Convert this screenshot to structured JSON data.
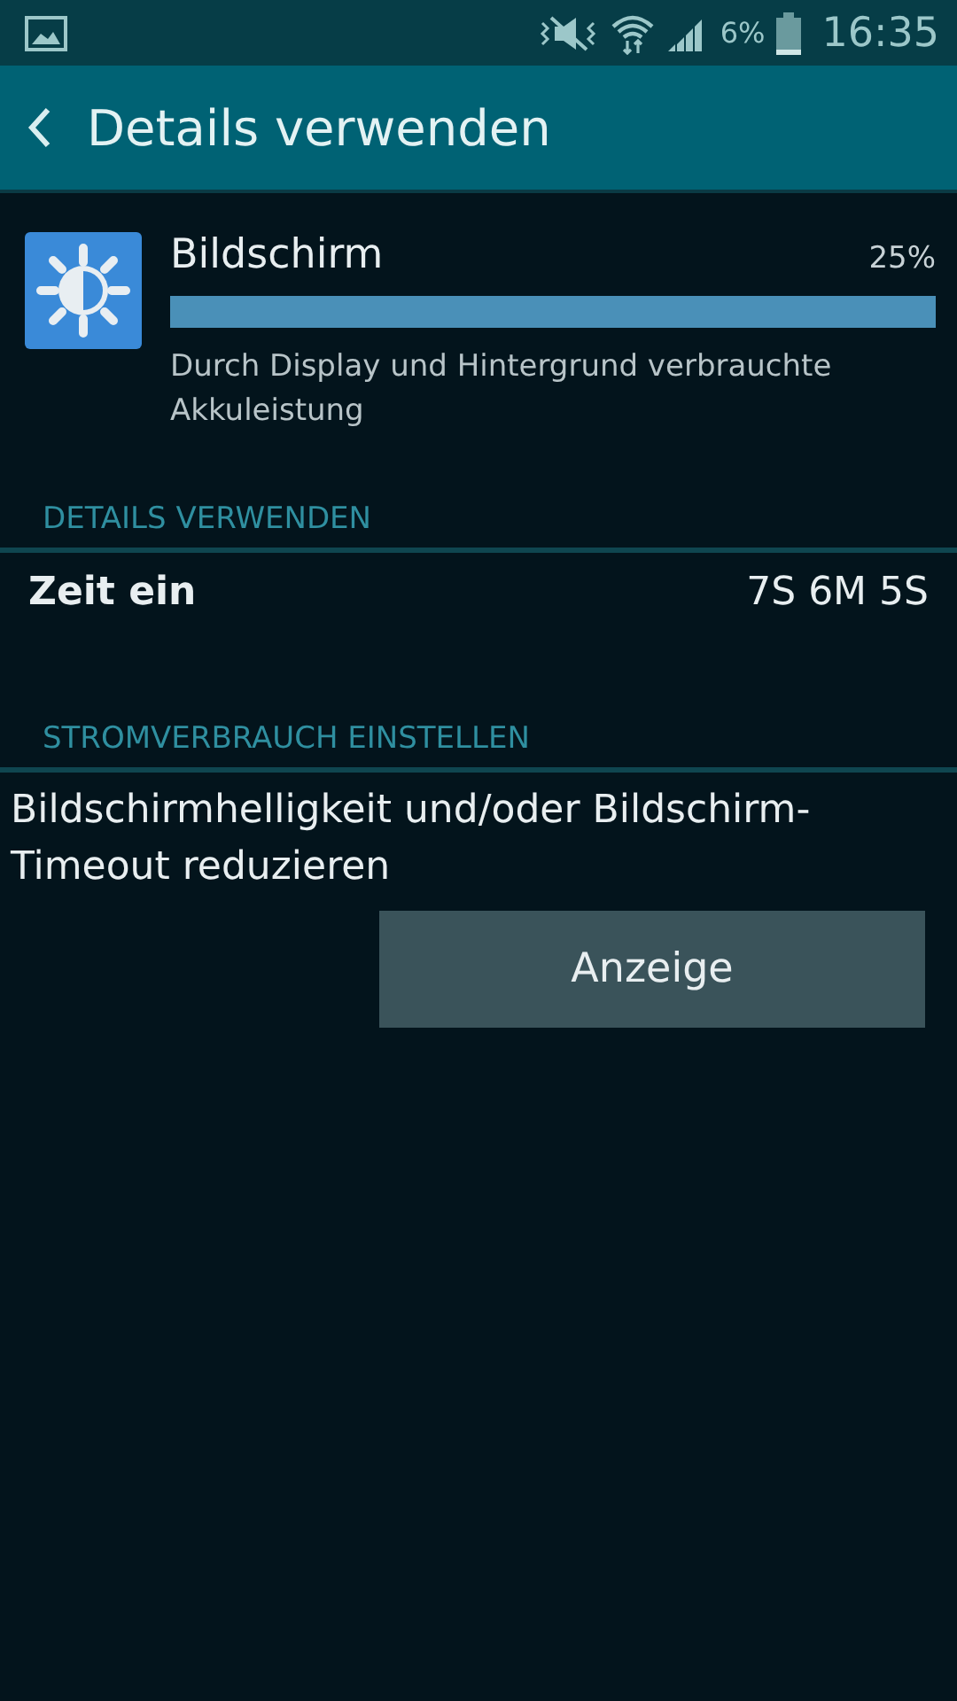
{
  "status_bar": {
    "battery": "6%",
    "time": "16:35"
  },
  "app_bar": {
    "title": "Details verwenden"
  },
  "app": {
    "name": "Bildschirm",
    "percent": "25%",
    "level": 1,
    "description": "Durch Display und Hintergrund verbrauchte Akkuleistung"
  },
  "sections": [
    {
      "header": "DETAILS VERWENDEN",
      "kind": "detail",
      "label": "Zeit ein",
      "value": "7S 6M 5S"
    },
    {
      "header": "STROMVERBRAUCH EINSTELLEN",
      "kind": "advice",
      "text": "Bildschirmhelligkeit und/oder Bildschirm-Timeout reduzieren",
      "button": "Anzeige"
    }
  ]
}
